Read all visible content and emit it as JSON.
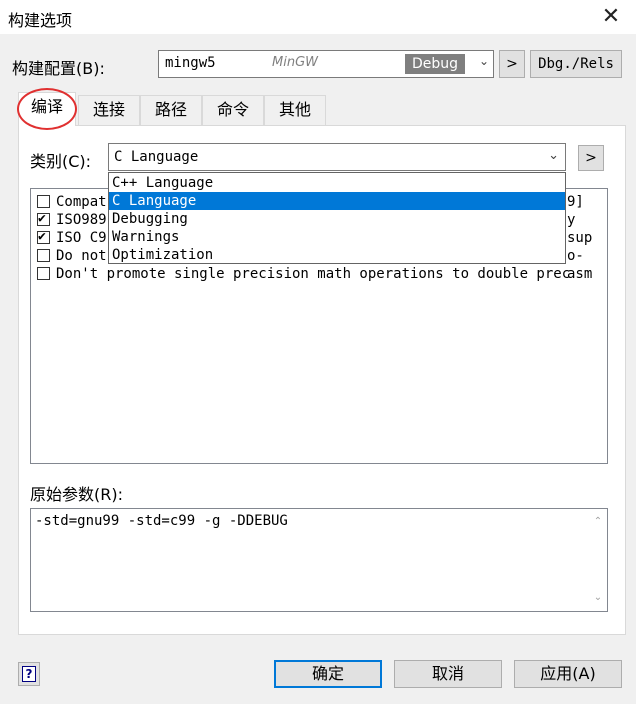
{
  "window": {
    "title": "构建选项",
    "close_glyph": "✕"
  },
  "build_config": {
    "label": "构建配置(B):",
    "name": "mingw5",
    "toolchain": "MinGW",
    "mode": "Debug",
    "nav_button": ">",
    "dbg_rels_button": "Dbg./Rels"
  },
  "tabs": [
    {
      "label": "编译",
      "active": true
    },
    {
      "label": "连接"
    },
    {
      "label": "路径"
    },
    {
      "label": "命令"
    },
    {
      "label": "其他"
    }
  ],
  "category": {
    "label": "类别(C):",
    "selected": "C Language",
    "nav_button": ">"
  },
  "dropdown": {
    "items": [
      "C++ Language",
      "C Language",
      "Debugging",
      "Warnings",
      "Optimization"
    ],
    "selected_index": 1
  },
  "options": [
    {
      "label": "Compat",
      "checked": false
    },
    {
      "label": "ISO989",
      "checked": true
    },
    {
      "label": "ISO C9",
      "checked": true
    },
    {
      "label": "Do not",
      "checked": false
    },
    {
      "label": "Don't promote single precision math operations to double prec",
      "checked": false
    }
  ],
  "options_partial_right": [
    {
      "text": "9]"
    },
    {
      "text": "y sup"
    },
    {
      "text": "o-asm"
    }
  ],
  "raw_params": {
    "label": "原始参数(R):",
    "value": "-std=gnu99 -std=c99 -g -DDEBUG"
  },
  "buttons": {
    "help": "?",
    "ok": "确定",
    "cancel": "取消",
    "apply": "应用(A)"
  },
  "colors": {
    "accent": "#0078d7",
    "annotation_circle": "#e03030",
    "mode_badge": "#7f7f7f"
  }
}
